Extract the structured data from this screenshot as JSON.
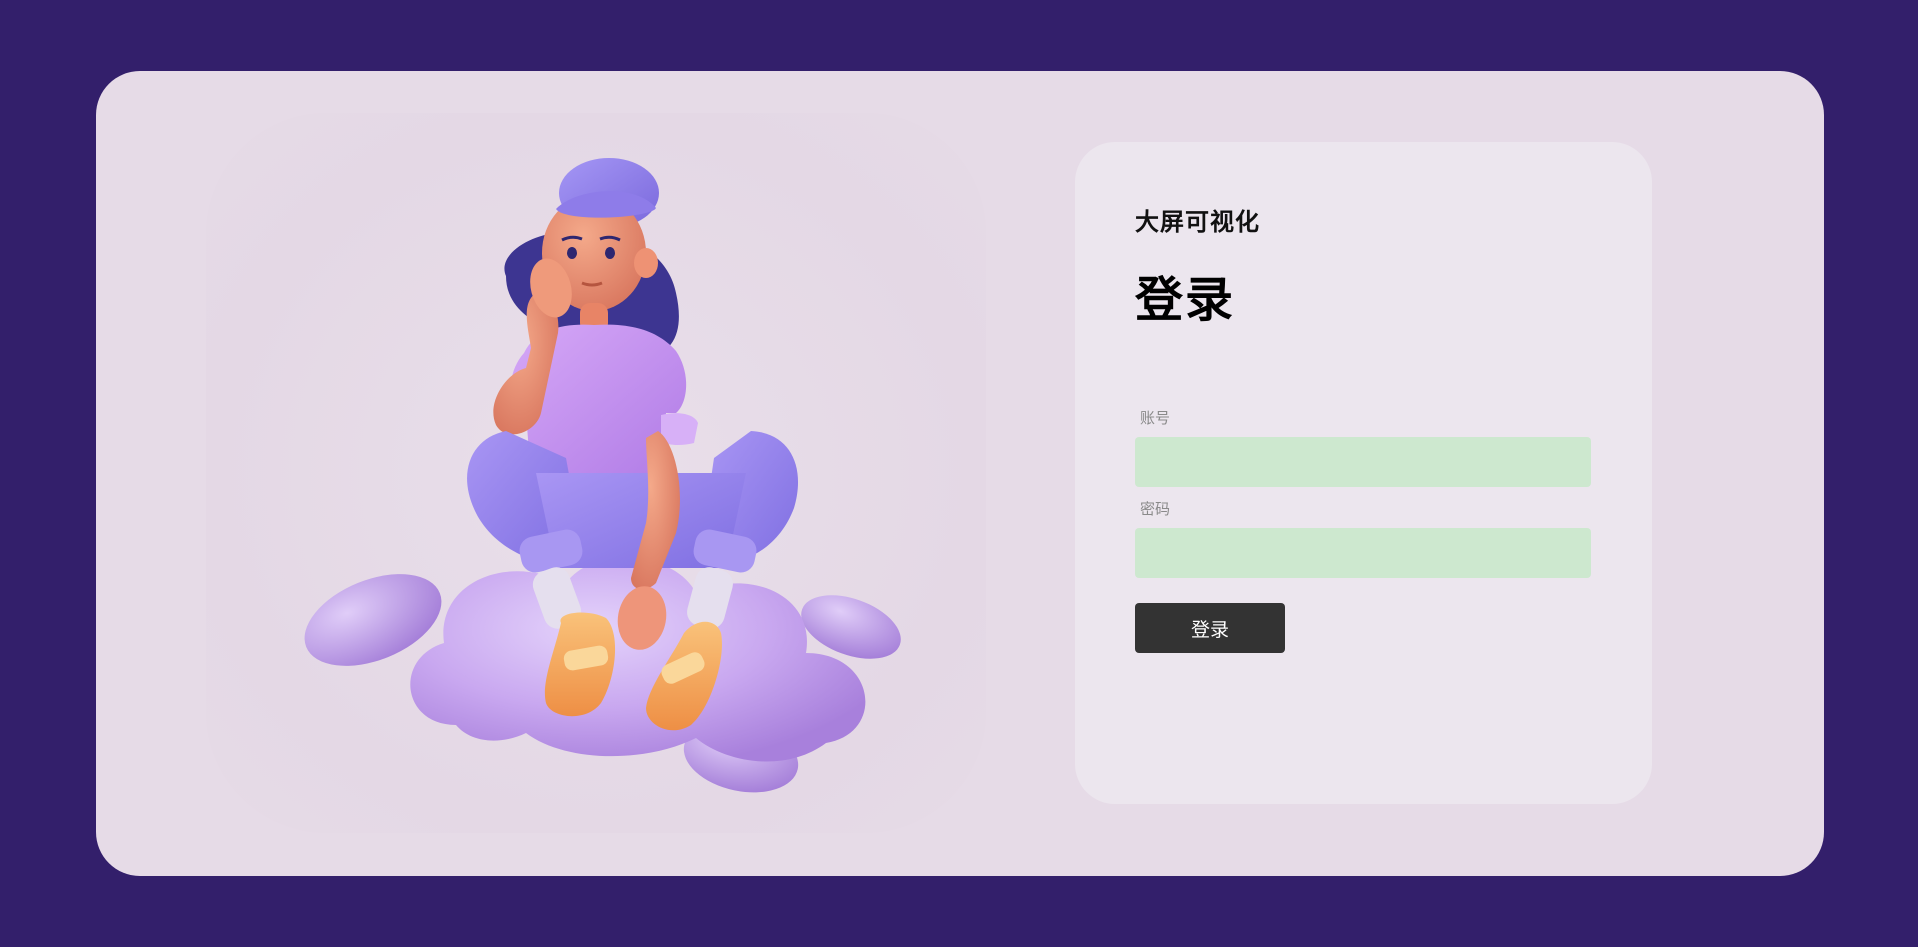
{
  "app": {
    "title": "大屏可视化"
  },
  "login": {
    "heading": "登录",
    "account_label": "账号",
    "account_value": "",
    "password_label": "密码",
    "password_value": "",
    "submit_label": "登录"
  },
  "colors": {
    "page_background": "#331f6b",
    "card_background": "#e6dbe7",
    "panel_background": "#ece6ee",
    "input_background": "#cde8cf",
    "button_background": "#333333"
  },
  "illustration": {
    "subject": "3d-girl-sitting-on-cloud"
  }
}
